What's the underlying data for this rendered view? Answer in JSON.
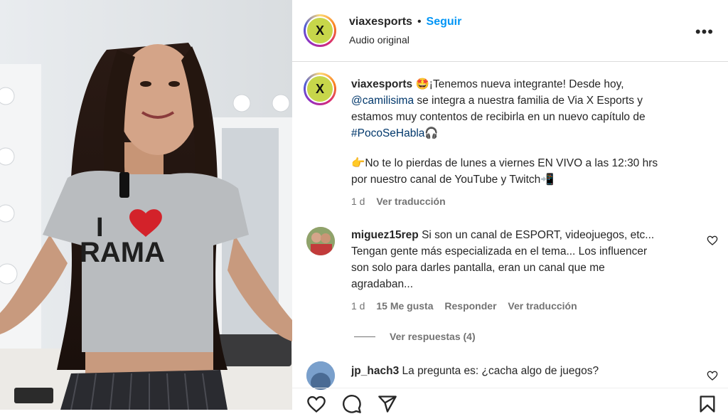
{
  "header": {
    "username": "viaxesports",
    "separator": "•",
    "follow_label": "Seguir",
    "audio": "Audio original",
    "more_label": "•••",
    "avatar_glyph": "X"
  },
  "caption": {
    "username": "viaxesports",
    "emoji": "🤩",
    "line1": "¡Tenemos nueva integrante! Desde hoy,",
    "mention": "@camilisima",
    "line2": " se integra a nuestra familia de Via X Esports y",
    "line3": "estamos muy contentos de recibirla en un nuevo capítulo de",
    "hashtag": "#PocoSeHabla",
    "hashtag_emoji": "🎧",
    "point_emoji": "👉",
    "line4": "No te lo pierdas de lunes a viernes EN VIVO a las 12:30 hrs",
    "line5": "por nuestro canal de YouTube y Twitch",
    "phone_emoji": "📲",
    "time": "1 d",
    "translate": "Ver traducción"
  },
  "comments": [
    {
      "username": "miguez15rep",
      "line1": "Si son un canal de ESPORT, videojuegos, etc...",
      "line2": "Tengan gente más especializada en el tema... Los influencer",
      "line3": "son solo para darles pantalla, eran un canal que me",
      "line4": "agradaban...",
      "time": "1 d",
      "likes": "15 Me gusta",
      "reply": "Responder",
      "translate": "Ver traducción",
      "replies": "Ver respuestas (4)"
    },
    {
      "username": "jp_hach3",
      "text": "La pregunta es: ¿cacha algo de juegos?"
    }
  ],
  "photo": {
    "shirt_text": "I",
    "shirt_text2": "RAMA"
  },
  "colors": {
    "accent": "#0095f6",
    "hashtag": "#00376b",
    "muted": "#737373"
  }
}
